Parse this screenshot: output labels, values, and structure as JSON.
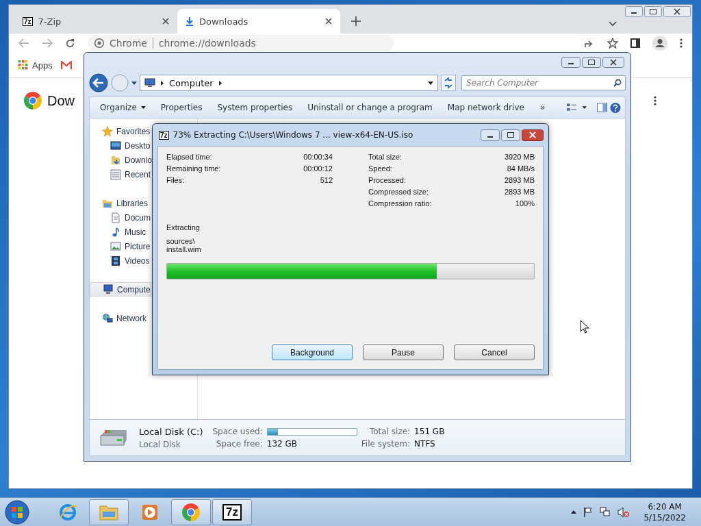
{
  "chrome": {
    "tabs": [
      {
        "label": "7-Zip",
        "icon_text": "7z",
        "selected": false
      },
      {
        "label": "Downloads",
        "selected": true
      }
    ],
    "omnibox": {
      "site_label": "Chrome",
      "url": "chrome://downloads"
    },
    "bookmarks": [
      {
        "label": "Apps"
      }
    ],
    "page_heading": "Dow"
  },
  "explorer": {
    "breadcrumb": [
      "Computer"
    ],
    "search": {
      "placeholder": "Search Computer"
    },
    "commands": [
      "Organize",
      "Properties",
      "System properties",
      "Uninstall or change a program",
      "Map network drive"
    ],
    "more": "»",
    "sidebar": [
      {
        "label": "Favorites",
        "kind": "favorites",
        "selected": false,
        "children": [
          {
            "label": "Deskto",
            "kind": "desktop",
            "selected": false
          },
          {
            "label": "Downlo",
            "kind": "downloads",
            "selected": false
          },
          {
            "label": "Recent",
            "kind": "recent",
            "selected": false
          }
        ]
      },
      {
        "label": "Libraries",
        "kind": "libraries",
        "selected": false,
        "children": [
          {
            "label": "Docum",
            "kind": "documents",
            "selected": false
          },
          {
            "label": "Music",
            "kind": "music",
            "selected": false
          },
          {
            "label": "Picture",
            "kind": "pictures",
            "selected": false
          },
          {
            "label": "Videos",
            "kind": "videos",
            "selected": false
          }
        ]
      },
      {
        "label": "Compute",
        "kind": "computer",
        "selected": true
      },
      {
        "label": "Network",
        "kind": "network",
        "selected": false
      }
    ],
    "details": {
      "name": "Local Disk (C:)",
      "type": "Local Disk",
      "used_label": "Space used:",
      "level": 0.12,
      "free_label": "Space free:",
      "free": "132 GB",
      "total_label": "Total size:",
      "total": "151 GB",
      "fs_label": "File system:",
      "fs": "NTFS"
    }
  },
  "dialog": {
    "icon_text": "7z",
    "title": "73% Extracting C:\\Users\\Windows 7 ... view-x64-EN-US.iso",
    "left_stats": [
      {
        "label": "Elapsed time:",
        "value": "00:00:34"
      },
      {
        "label": "Remaining time:",
        "value": "00:00:12"
      },
      {
        "label": "Files:",
        "value": "512"
      }
    ],
    "right_stats": [
      {
        "label": "Total size:",
        "value": "3920 MB"
      },
      {
        "label": "Speed:",
        "value": "84 MB/s"
      },
      {
        "label": "Processed:",
        "value": "2893 MB"
      },
      {
        "label": "Compressed size:",
        "value": "2893 MB"
      },
      {
        "label": "Compression ratio:",
        "value": "100%"
      }
    ],
    "status": "Extracting",
    "path": [
      "sources\\",
      "install.wim"
    ],
    "progress": {
      "level": 0.736
    },
    "buttons": [
      {
        "label": "Background",
        "focused": true
      },
      {
        "label": "Pause",
        "focused": false
      },
      {
        "label": "Cancel",
        "focused": false
      }
    ]
  },
  "taskbar": {
    "items": [
      {
        "kind": "ie",
        "running": false
      },
      {
        "kind": "explorer",
        "running": true
      },
      {
        "kind": "media",
        "running": false
      },
      {
        "kind": "chrome",
        "running": true
      },
      {
        "kind": "sevenzip",
        "running": true,
        "icon_text": "7z"
      }
    ],
    "time": "6:20 AM",
    "date": "5/15/2022"
  }
}
